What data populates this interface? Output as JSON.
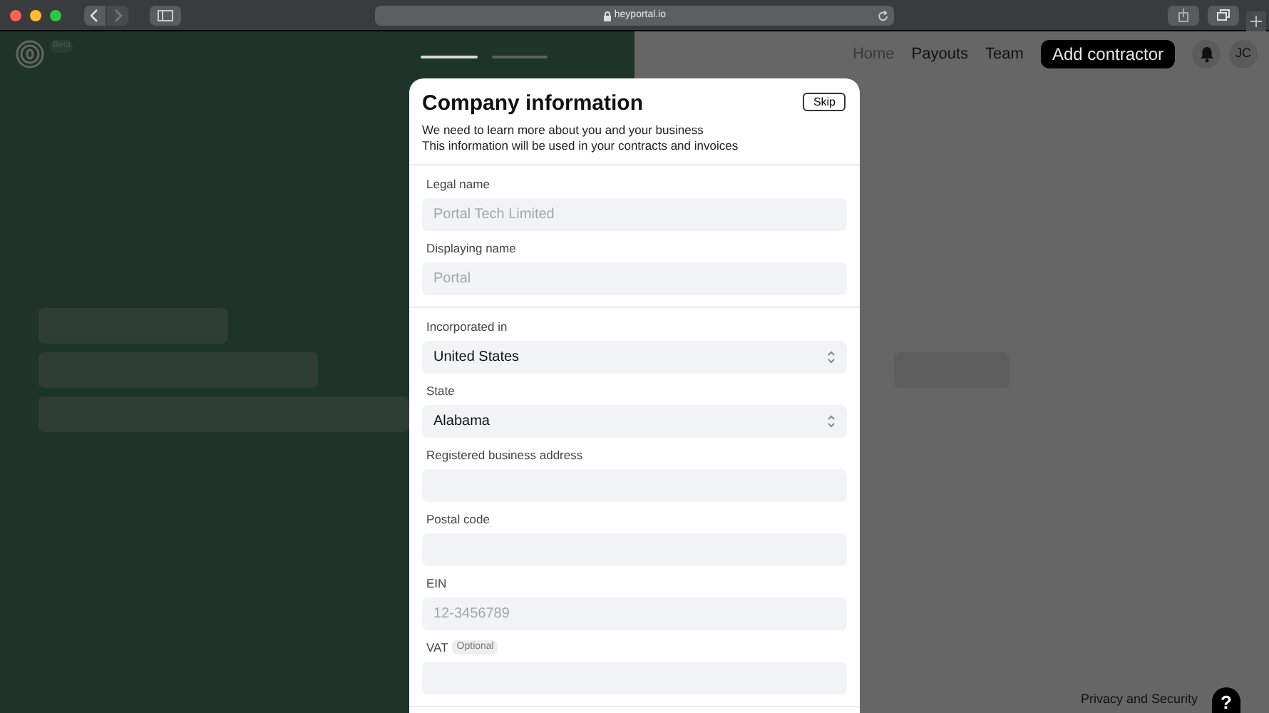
{
  "browser": {
    "url": "heyportal.io"
  },
  "app": {
    "badge": "Beta",
    "nav": [
      {
        "label": "Home",
        "selected": true
      },
      {
        "label": "Payouts",
        "selected": false
      },
      {
        "label": "Team",
        "selected": false
      }
    ],
    "primary_button": "Add contractor",
    "avatar": "JC"
  },
  "steps": [
    {
      "selected": true
    },
    {
      "selected": false
    }
  ],
  "modal": {
    "title": "Company information",
    "skip": "Skip",
    "subtitle": [
      "We need to learn more about you and your business",
      "This information will be used in your contracts and invoices"
    ],
    "sections": [
      {
        "fields": [
          {
            "kind": "text",
            "label": "Legal name",
            "placeholder": "Portal Tech Limited"
          },
          {
            "kind": "text",
            "label": "Displaying name",
            "placeholder": "Portal"
          }
        ]
      },
      {
        "fields": [
          {
            "kind": "select",
            "label": "Incorporated in",
            "value": "United States"
          },
          {
            "kind": "select",
            "label": "State",
            "value": "Alabama"
          },
          {
            "kind": "text",
            "label": "Registered business address"
          },
          {
            "kind": "text",
            "label": "Postal code"
          },
          {
            "kind": "text",
            "label": "EIN",
            "placeholder": "12-3456789"
          },
          {
            "kind": "text",
            "label": "VAT",
            "badge": "Optional"
          }
        ]
      }
    ]
  },
  "footer": {
    "link": "Privacy and Security",
    "help": "?"
  }
}
